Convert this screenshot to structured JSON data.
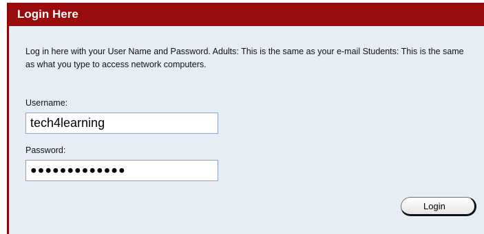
{
  "panel": {
    "title": "Login Here",
    "intro_text": "Log in here with your User Name and Password. Adults: This is the same as your e-mail Students: This is the same as what you type to access network computers."
  },
  "form": {
    "username_label": "Username:",
    "username_value": "tech4learning",
    "password_label": "Password:",
    "password_value": "●●●●●●●●●●●●●",
    "login_label": "Login"
  },
  "colors": {
    "header_bg": "#9a0b0b",
    "panel_bg": "#e7edf4"
  }
}
